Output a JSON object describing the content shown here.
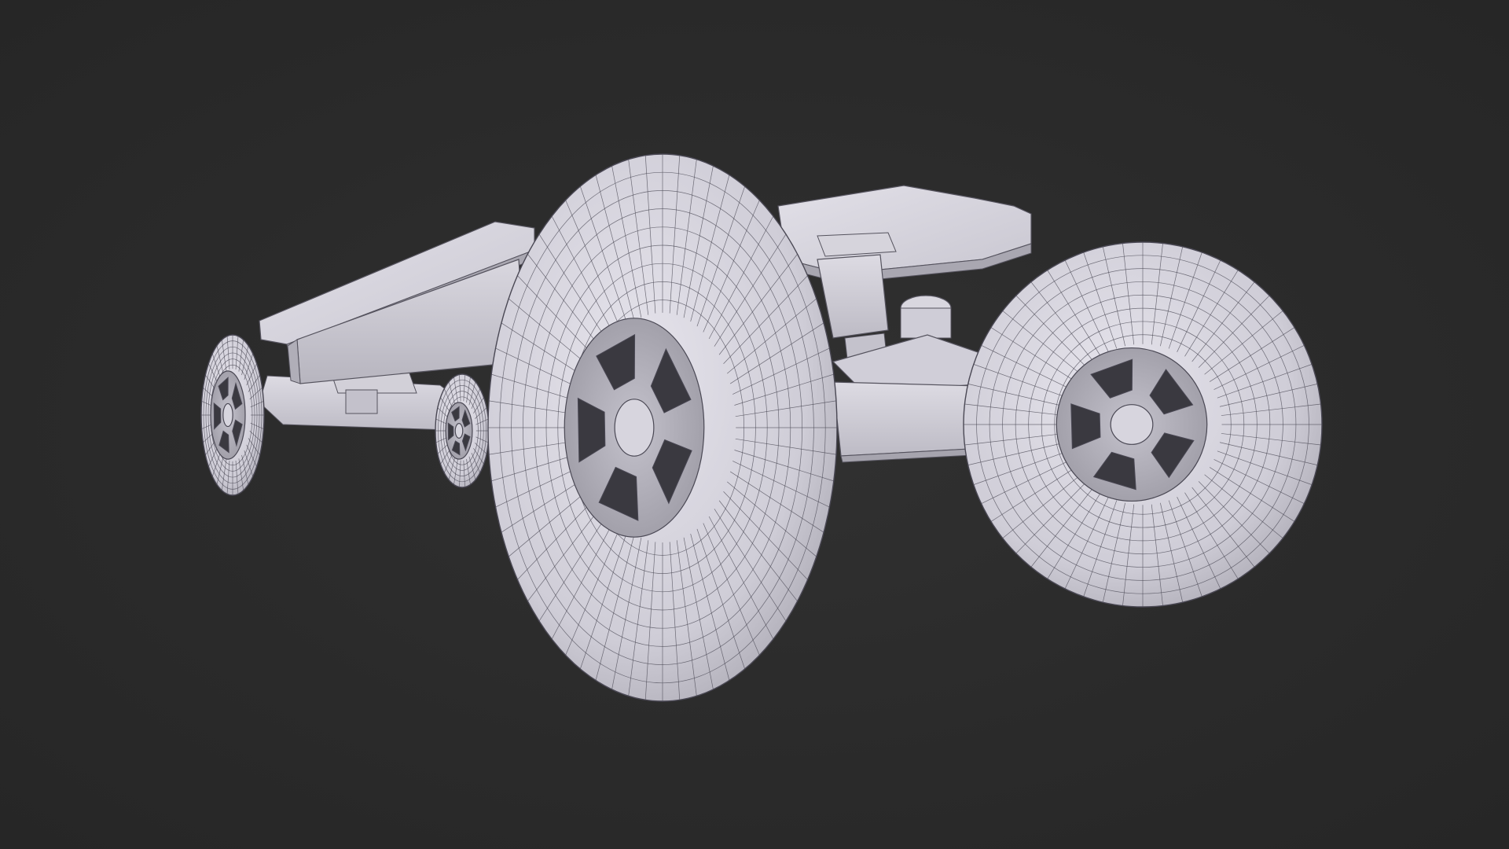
{
  "viewport": {
    "background_color": "#2b2b2b",
    "model_surface_color": "#c8c6d0",
    "wire_color": "#4a4854"
  },
  "model": {
    "subject": "electric-all-terrain-skateboard-wireframe",
    "wheel_count": 4,
    "hub_spoke_count": 5
  }
}
